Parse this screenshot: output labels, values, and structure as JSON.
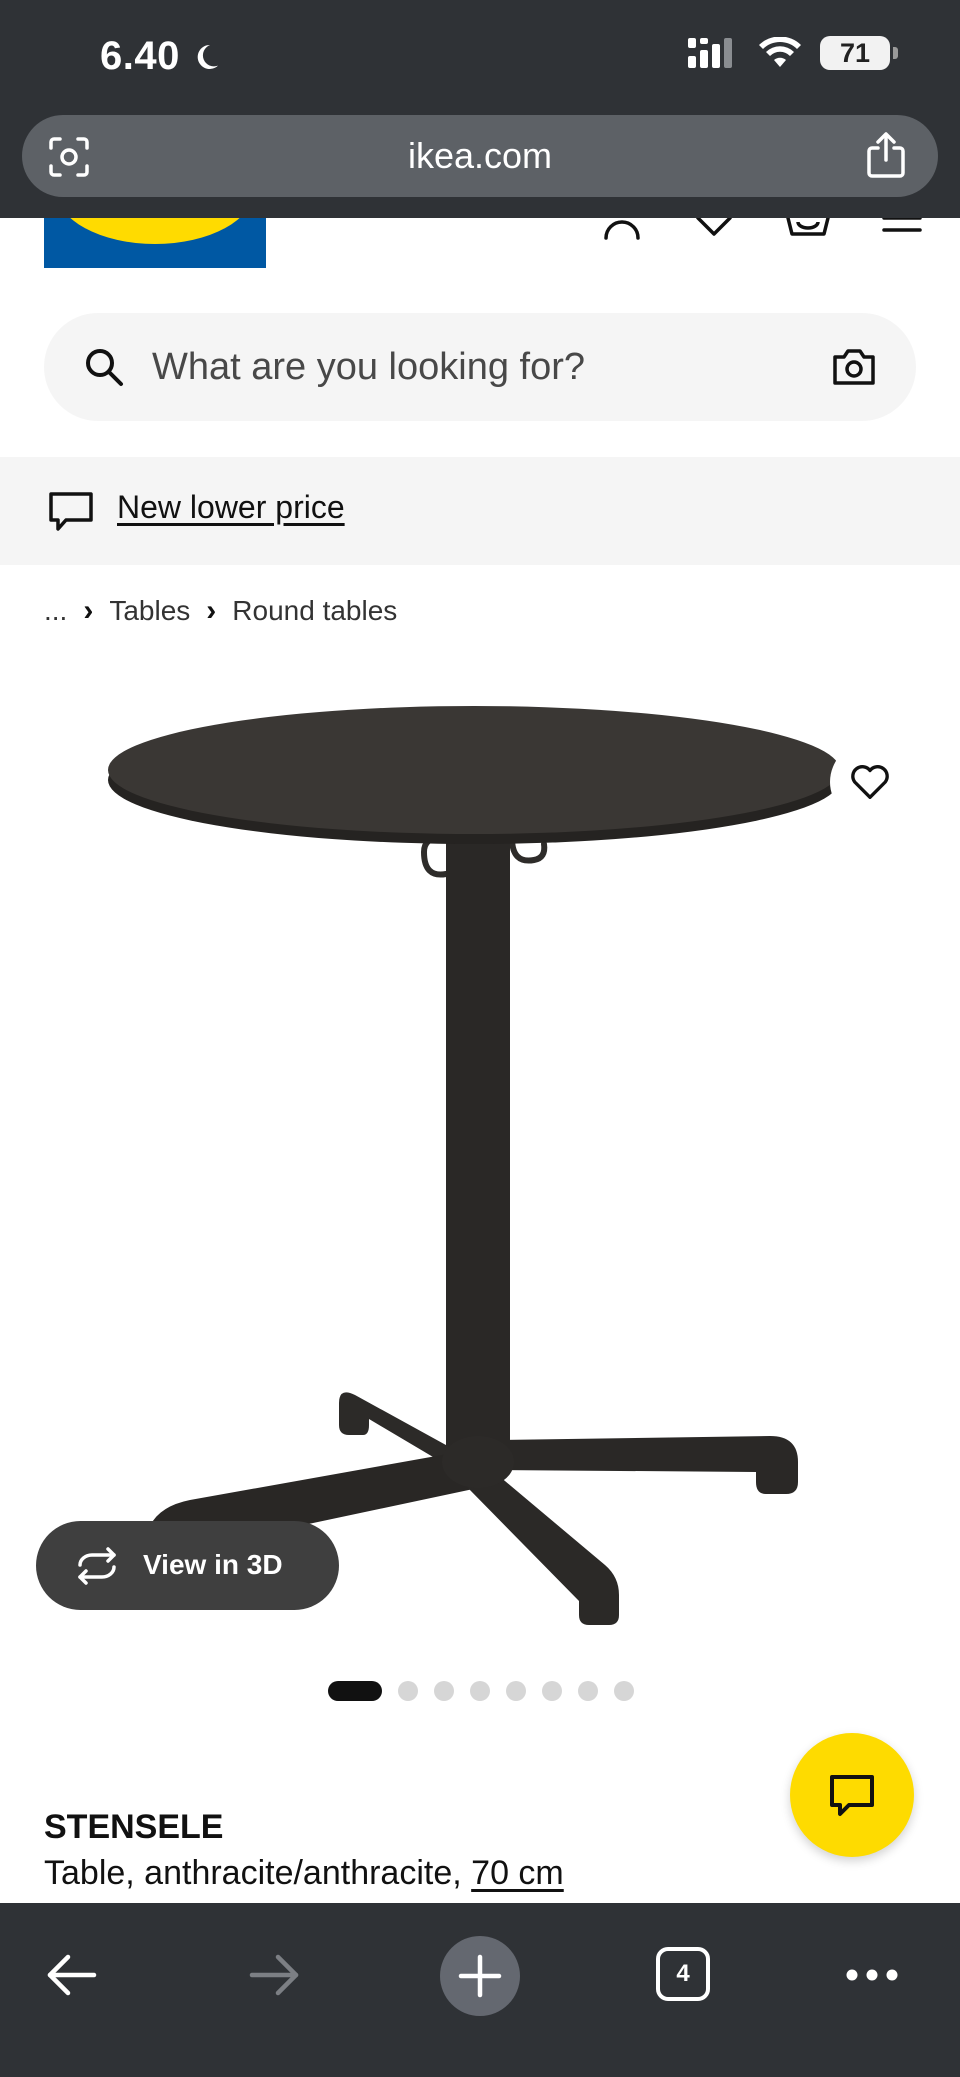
{
  "status_bar": {
    "time": "6.40",
    "battery": "71"
  },
  "browser": {
    "url": "ikea.com",
    "open_tabs": "4"
  },
  "header": {
    "logo_text": "IKEA"
  },
  "search": {
    "placeholder": "What are you looking for?"
  },
  "promo": {
    "label": "New lower price"
  },
  "breadcrumb": {
    "ellipsis": "...",
    "items": [
      "Tables",
      "Round tables"
    ]
  },
  "gallery": {
    "view_3d_label": "View in 3D",
    "image_count": 8,
    "active_index": 0
  },
  "product": {
    "name": "STENSELE",
    "description": "Table, anthracite/anthracite, ",
    "size": "70 cm"
  },
  "colors": {
    "ikea_blue": "#0058a3",
    "ikea_yellow": "#ffdb00",
    "chrome": "#2f3236"
  },
  "icons": [
    "lens-icon",
    "share-icon",
    "account-icon",
    "heart-icon",
    "basket-icon",
    "menu-icon",
    "search-icon",
    "camera-icon",
    "speech-bubble-icon",
    "rotate-3d-icon",
    "chat-icon",
    "back-arrow-icon",
    "forward-arrow-icon",
    "plus-icon",
    "tabs-icon",
    "more-icon"
  ]
}
